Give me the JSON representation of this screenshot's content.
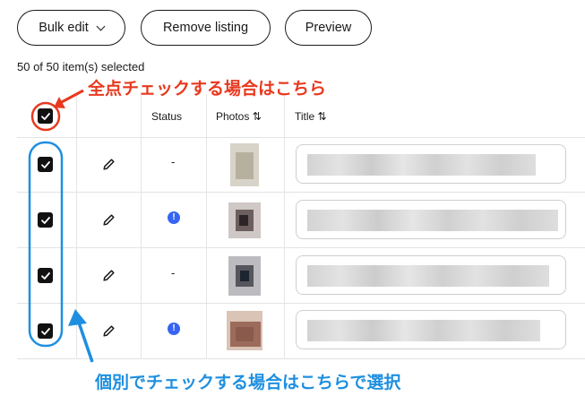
{
  "toolbar": {
    "bulk_edit_label": "Bulk edit",
    "remove_listing_label": "Remove listing",
    "preview_label": "Preview"
  },
  "selection": {
    "count_text": "50 of 50 item(s) selected"
  },
  "table": {
    "columns": [
      "Status",
      "Photos ⇅",
      "Title ⇅"
    ],
    "rows": [
      {
        "selected": true,
        "status": "-"
      },
      {
        "selected": true,
        "status": "!"
      },
      {
        "selected": true,
        "status": "-"
      },
      {
        "selected": true,
        "status": "!"
      }
    ]
  },
  "annotations": {
    "select_all": "全点チェックする場合はこちら",
    "select_individual": "個別でチェックする場合はこちらで選択"
  },
  "colors": {
    "annotation_red": "#e8391f",
    "annotation_blue": "#1e8fe0",
    "info_badge": "#3665f3"
  }
}
